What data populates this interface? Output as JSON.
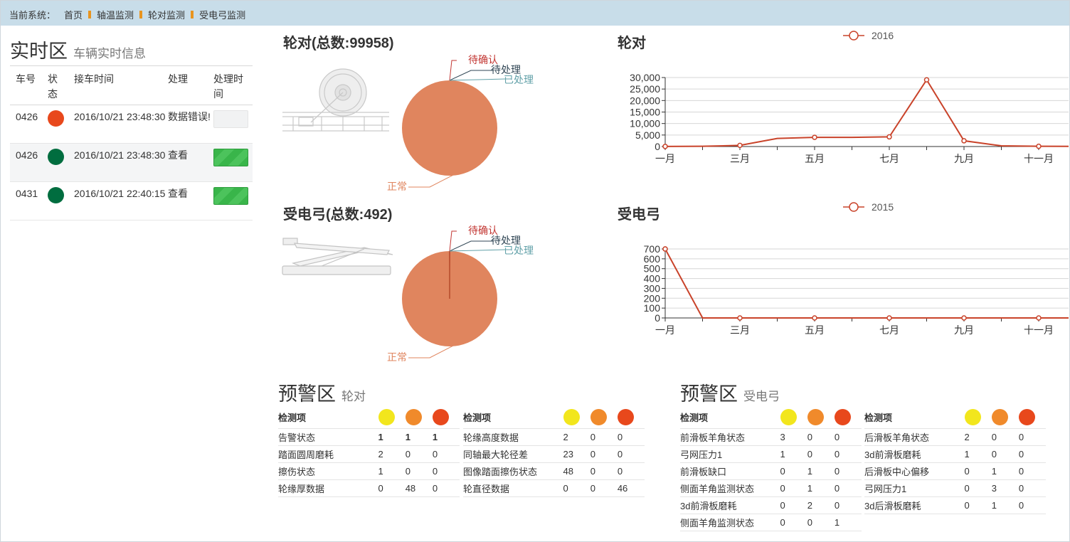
{
  "colors": {
    "red": "#e8481c",
    "green": "#006d3f",
    "yellow": "#f2e61d",
    "orange": "#f08a2b",
    "pie": "#e0855e",
    "line": "#c9432a",
    "bar_bg": "#c8dde9",
    "separator": "#e8941f"
  },
  "topbar": {
    "label": "当前系统：",
    "crumbs": [
      "首页",
      "轴温监测",
      "轮对监测",
      "受电弓监测"
    ]
  },
  "realtime": {
    "title": "实时区",
    "subtitle": "车辆实时信息",
    "headers": [
      "车号",
      "状态",
      "接车时间",
      "处理",
      "处理时间"
    ],
    "rows": [
      {
        "car": "0426",
        "status": "red",
        "time": "2016/10/21 23:48:30",
        "action": "数据错误!",
        "button": "empty"
      },
      {
        "car": "0426",
        "status": "green",
        "time": "2016/10/21 23:48:30",
        "action": "查看",
        "button": "go"
      },
      {
        "car": "0431",
        "status": "green",
        "time": "2016/10/21 22:40:15",
        "action": "查看",
        "button": "go"
      }
    ]
  },
  "charts": {
    "wheel_pie_title": "轮对(总数:99958)",
    "wheel_line_title": "轮对",
    "pantograph_pie_title": "受电弓(总数:492)",
    "pantograph_line_title": "受电弓"
  },
  "chart_data": [
    {
      "type": "pie",
      "title": "轮对(总数:99958)",
      "labels": [
        "待确认",
        "待处理",
        "已处理",
        "正常"
      ],
      "values": [
        0,
        0,
        0,
        99958
      ]
    },
    {
      "type": "line",
      "title": "轮对",
      "legend": "2016",
      "legend_position": "top-center",
      "categories": [
        "一月",
        "二月",
        "三月",
        "四月",
        "五月",
        "六月",
        "七月",
        "八月",
        "九月",
        "十月",
        "十一月",
        "十二月"
      ],
      "tick_labels": [
        "一月",
        "三月",
        "五月",
        "七月",
        "九月",
        "十一月"
      ],
      "values": [
        50,
        100,
        500,
        3500,
        4000,
        4000,
        4200,
        29000,
        2500,
        300,
        100,
        50
      ],
      "ylim": [
        0,
        30000
      ],
      "yticks": [
        "0",
        "5,000",
        "10,000",
        "15,000",
        "20,000",
        "25,000",
        "30,000"
      ],
      "grid": true
    },
    {
      "type": "pie",
      "title": "受电弓(总数:492)",
      "labels": [
        "待确认",
        "待处理",
        "已处理",
        "正常"
      ],
      "values": [
        1,
        0,
        0,
        491
      ]
    },
    {
      "type": "line",
      "title": "受电弓",
      "legend": "2015",
      "legend_position": "top-center",
      "categories": [
        "一月",
        "二月",
        "三月",
        "四月",
        "五月",
        "六月",
        "七月",
        "八月",
        "九月",
        "十月",
        "十一月",
        "十二月"
      ],
      "tick_labels": [
        "一月",
        "三月",
        "五月",
        "七月",
        "九月",
        "十一月"
      ],
      "values": [
        700,
        0,
        0,
        0,
        0,
        0,
        0,
        0,
        0,
        0,
        0,
        0
      ],
      "ylim": [
        0,
        700
      ],
      "yticks": [
        "0",
        "100",
        "200",
        "300",
        "400",
        "500",
        "600",
        "700"
      ],
      "grid": true
    }
  ],
  "warn_wheel": {
    "title": "预警区",
    "subtitle": "轮对",
    "header": "检测项",
    "left": [
      {
        "name": "告警状态",
        "v": [
          "1",
          "1",
          "1"
        ]
      },
      {
        "name": "踏面圆周磨耗",
        "v": [
          "2",
          "0",
          "0"
        ]
      },
      {
        "name": "擦伤状态",
        "v": [
          "1",
          "0",
          "0"
        ]
      },
      {
        "name": "轮缘厚数据",
        "v": [
          "0",
          "48",
          "0"
        ]
      }
    ],
    "right": [
      {
        "name": "轮缘高度数据",
        "v": [
          "2",
          "0",
          "0"
        ]
      },
      {
        "name": "同轴最大轮径差",
        "v": [
          "23",
          "0",
          "0"
        ]
      },
      {
        "name": "图像踏面擦伤状态",
        "v": [
          "48",
          "0",
          "0"
        ]
      },
      {
        "name": "轮直径数据",
        "v": [
          "0",
          "0",
          "46"
        ]
      }
    ]
  },
  "warn_panto": {
    "title": "预警区",
    "subtitle": "受电弓",
    "header": "检测项",
    "left": [
      {
        "name": "前滑板羊角状态",
        "v": [
          "3",
          "0",
          "0"
        ]
      },
      {
        "name": "弓网压力1",
        "v": [
          "1",
          "0",
          "0"
        ]
      },
      {
        "name": "前滑板缺口",
        "v": [
          "0",
          "1",
          "0"
        ]
      },
      {
        "name": "侧面羊角监测状态",
        "v": [
          "0",
          "1",
          "0"
        ]
      },
      {
        "name": "3d前滑板磨耗",
        "v": [
          "0",
          "2",
          "0"
        ]
      },
      {
        "name": "侧面羊角监测状态",
        "v": [
          "0",
          "0",
          "1"
        ]
      }
    ],
    "right": [
      {
        "name": "后滑板羊角状态",
        "v": [
          "2",
          "0",
          "0"
        ]
      },
      {
        "name": "3d前滑板磨耗",
        "v": [
          "1",
          "0",
          "0"
        ]
      },
      {
        "name": "后滑板中心偏移",
        "v": [
          "0",
          "1",
          "0"
        ]
      },
      {
        "name": "弓网压力1",
        "v": [
          "0",
          "3",
          "0"
        ]
      },
      {
        "name": "3d后滑板磨耗",
        "v": [
          "0",
          "1",
          "0"
        ]
      }
    ]
  }
}
